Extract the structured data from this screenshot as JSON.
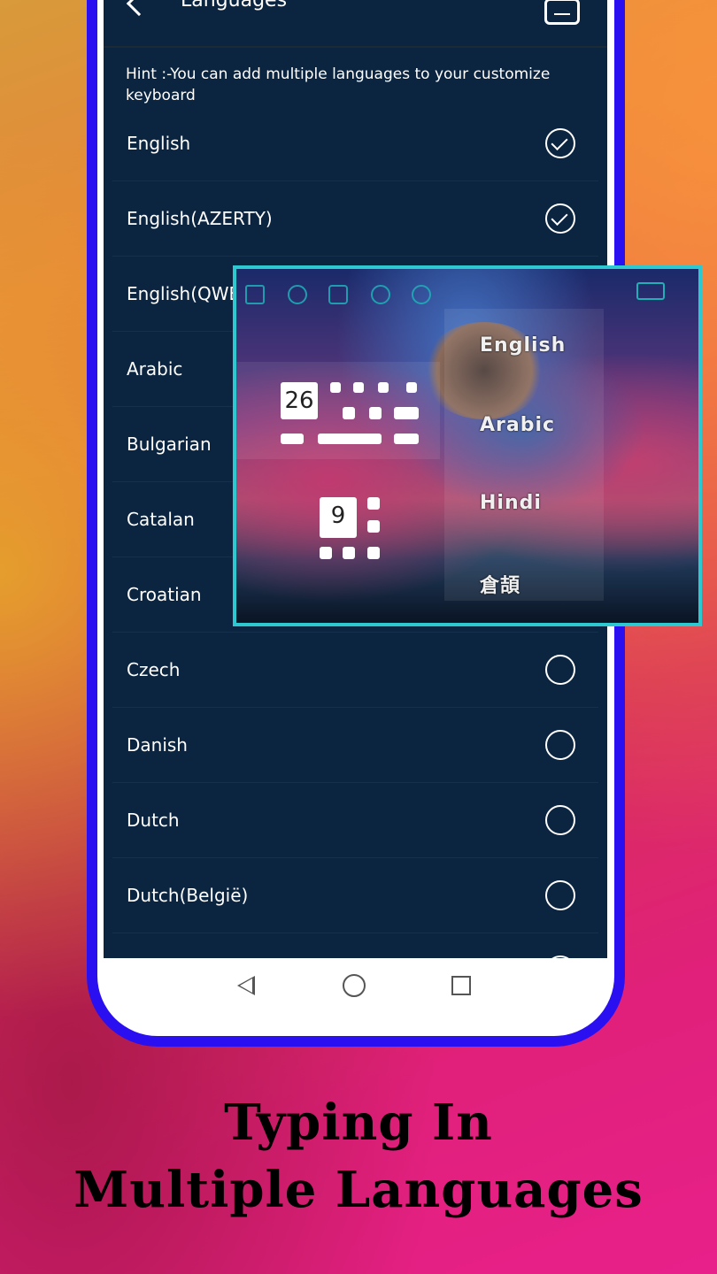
{
  "header": {
    "title": "Languages",
    "back_icon": "back-arrow-icon",
    "menu_icon": "menu-icon"
  },
  "hint": "Hint :-You can add multiple languages to your customize keyboard",
  "languages": [
    {
      "name": "English",
      "selected": true
    },
    {
      "name": "English(AZERTY)",
      "selected": true
    },
    {
      "name": "English(QWERTZ)",
      "selected": true
    },
    {
      "name": "Arabic",
      "selected": false
    },
    {
      "name": "Bulgarian",
      "selected": false
    },
    {
      "name": "Catalan",
      "selected": false
    },
    {
      "name": "Croatian",
      "selected": false
    },
    {
      "name": "Czech",
      "selected": false
    },
    {
      "name": "Danish",
      "selected": false
    },
    {
      "name": "Dutch",
      "selected": false
    },
    {
      "name": "Dutch(België)",
      "selected": false
    }
  ],
  "keyboard_preview": {
    "key_count_letters": "26",
    "key_count_numbers": "9",
    "languages": [
      "English",
      "Arabic",
      "Hindi",
      "倉頡"
    ],
    "toolbar_icons": [
      "apps-icon",
      "emoji-icon",
      "theme-shirt-icon",
      "globe-icon",
      "settings-icon",
      "keyboard-icon"
    ],
    "border_color": "#2dc8d0"
  },
  "tagline": {
    "line1": "Typing In",
    "line2": "Multiple Languages"
  },
  "colors": {
    "phone_frame": "#2a10f0",
    "screen_bg": "#0b2440"
  }
}
